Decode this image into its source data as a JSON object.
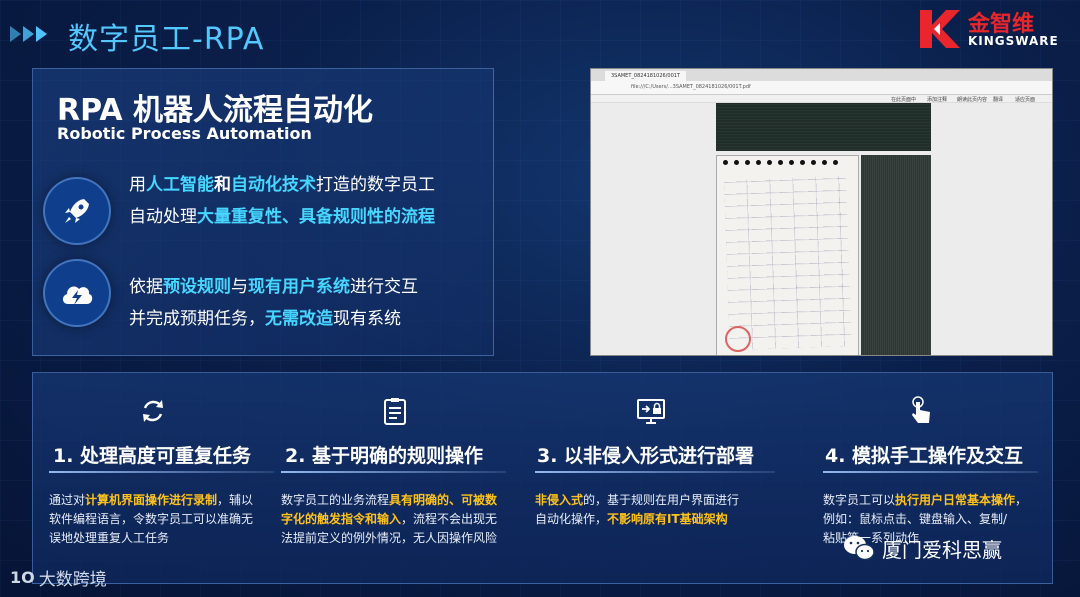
{
  "header": {
    "title": "数字员工-RPA",
    "brand_cn": "金智维",
    "brand_en": "KINGSWARE"
  },
  "intro": {
    "title": "RPA 机器人流程自动化",
    "subtitle": "Robotic Process Automation",
    "feature1": {
      "icon": "rocket-icon",
      "line1": [
        "用",
        "人工智能",
        "和",
        "自动化技术",
        "打造的数字员工"
      ],
      "line2": [
        "自动处理",
        "大量重复性、具备规则性的流程"
      ]
    },
    "feature2": {
      "icon": "cloud-lightning-icon",
      "line1": [
        "依据",
        "预设规则",
        "与",
        "现有用户系统",
        "进行交互"
      ],
      "line2": [
        "并完成预期任务，",
        "无需改造",
        "现有系统"
      ]
    }
  },
  "screenshot": {
    "tab": "3SAMET_0824181026/001T",
    "url": "file:///C:/Users/...3SAMET_0824181026/001T.pdf",
    "tools": [
      "在此页面中",
      "添加注释",
      "朗读此页内容",
      "翻译",
      "适应页面"
    ]
  },
  "features": [
    {
      "icon": "refresh-icon",
      "title": "1. 处理高度可重复任务",
      "text": [
        [
          "通过对",
          "计算机界面操作进行录制",
          "，辅以"
        ],
        [
          "软件编程语言，令数字员工可以准确无"
        ],
        [
          "误地处理重复人工任务"
        ]
      ]
    },
    {
      "icon": "checklist-icon",
      "title": "2. 基于明确的规则操作",
      "text": [
        [
          "数字员工的业务流程",
          "具有明确的、可被数"
        ],
        [
          "字化的触发指令和输入",
          "，流程不会出现无"
        ],
        [
          "法提前定义的例外情况，无人因操作风险"
        ]
      ]
    },
    {
      "icon": "monitor-lock-icon",
      "title": "3. 以非侵入形式进行部署",
      "text": [
        [
          "非侵入式",
          "的，基于规则在用户界面进行"
        ],
        [
          "自动化操作，",
          "不影响原有IT基础架构"
        ]
      ]
    },
    {
      "icon": "hand-tap-icon",
      "title": "4. 模拟手工操作及交互",
      "text": [
        [
          "数字员工可以",
          "执行用户日常基本操作",
          "，"
        ],
        [
          "例如：鼠标点击、键盘输入、复制/"
        ],
        [
          "粘贴等一系列动作"
        ]
      ]
    }
  ],
  "watermark_left": "大数跨境",
  "watermark_left_logo": "1O",
  "watermark_right": "厦门爱科思赢",
  "colors": {
    "accent_cyan": "#46d6ff",
    "highlight_gold": "#ffc21a",
    "brand_red": "#e8262b"
  }
}
